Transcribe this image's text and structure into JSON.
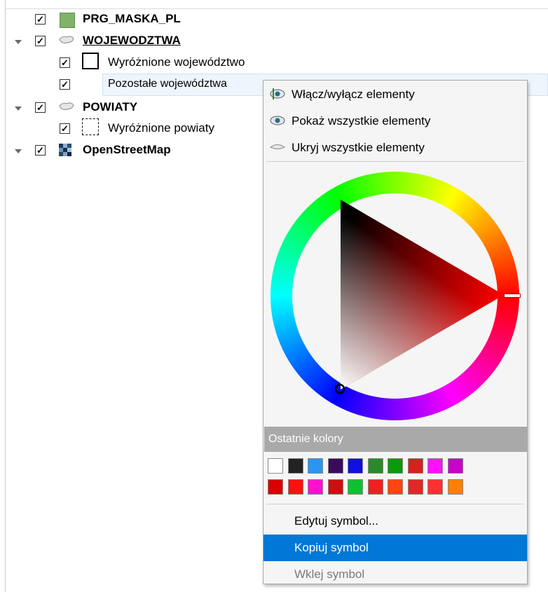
{
  "layers": [
    {
      "label": "PRG_MASKA_PL",
      "checked": "✓",
      "symbol_color": "#82b26a"
    },
    {
      "label": "WOJEWODZTWA",
      "checked": "✓"
    },
    {
      "label": "Wyróżnione województwo",
      "checked": "✓"
    },
    {
      "label": "Pozostałe województwa",
      "checked": "✓"
    },
    {
      "label": "POWIATY",
      "checked": "✓"
    },
    {
      "label": "Wyróżnione powiaty",
      "checked": "✓"
    },
    {
      "label": "OpenStreetMap",
      "checked": "✓"
    }
  ],
  "menu": {
    "toggle": "Włącz/wyłącz elementy",
    "show_all": "Pokaż wszystkie elementy",
    "hide_all": "Ukryj wszystkie elementy",
    "recent_colors_label": "Ostatnie kolory",
    "edit_symbol": "Edytuj symbol...",
    "copy_symbol": "Kopiuj symbol",
    "paste_symbol": "Wklej symbol"
  },
  "color_picker": {
    "hue_color": "#ff0000",
    "current_color": "#ffffff"
  },
  "recent_colors": [
    [
      "#ffffff",
      "#222222",
      "#2a96f0",
      "#3a0b5c",
      "#1010e0",
      "#2a8a2a",
      "#0a9a0a",
      "#d82020",
      "#ff10ff",
      "#c800c8"
    ],
    [
      "#d80000",
      "#ff1010",
      "#ff10d0",
      "#cc1010",
      "#10c030",
      "#f02020",
      "#ff4410",
      "#e02828",
      "#ff3030",
      "#ff8000"
    ]
  ]
}
